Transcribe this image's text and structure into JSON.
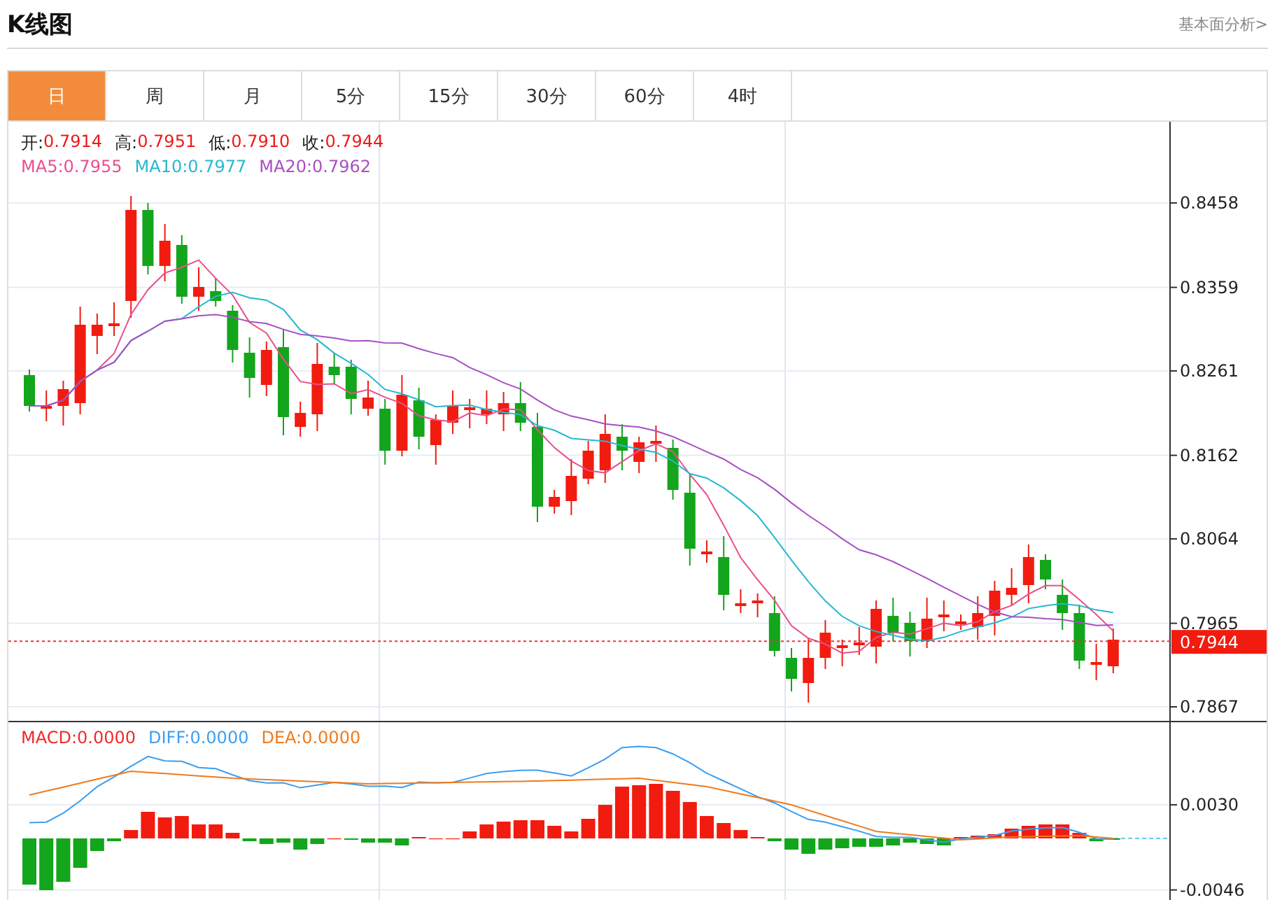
{
  "header": {
    "title": "K线图",
    "link": "基本面分析>"
  },
  "tabs": [
    {
      "label": "日",
      "selected": true
    },
    {
      "label": "周",
      "selected": false
    },
    {
      "label": "月",
      "selected": false
    },
    {
      "label": "5分",
      "selected": false
    },
    {
      "label": "15分",
      "selected": false
    },
    {
      "label": "30分",
      "selected": false
    },
    {
      "label": "60分",
      "selected": false
    },
    {
      "label": "4时",
      "selected": false
    }
  ],
  "price_legend": [
    {
      "label": "开:",
      "value": "0.7914"
    },
    {
      "label": "高:",
      "value": "0.7951"
    },
    {
      "label": "低:",
      "value": "0.7910"
    },
    {
      "label": "收:",
      "value": "0.7944"
    }
  ],
  "ma_legend": [
    {
      "label": "MA5:",
      "value": "0.7955",
      "color": "#e8508c"
    },
    {
      "label": "MA10:",
      "value": "0.7977",
      "color": "#26b8d0"
    },
    {
      "label": "MA20:",
      "value": "0.7962",
      "color": "#a94fc4"
    }
  ],
  "price_axis": {
    "ticks": [
      "0.8458",
      "0.8359",
      "0.8261",
      "0.8162",
      "0.8064",
      "0.7965",
      "0.7867"
    ],
    "current_price": "0.7944"
  },
  "macd_legend": [
    {
      "label": "MACD:",
      "value": "0.0000",
      "color": "#ee2a2a"
    },
    {
      "label": "DIFF:",
      "value": "0.0000",
      "color": "#3d9ef0"
    },
    {
      "label": "DEA:",
      "value": "0.0000",
      "color": "#f07a1c"
    }
  ],
  "macd_axis": {
    "ticks": [
      "0.0030",
      "-0.0046"
    ]
  }
}
